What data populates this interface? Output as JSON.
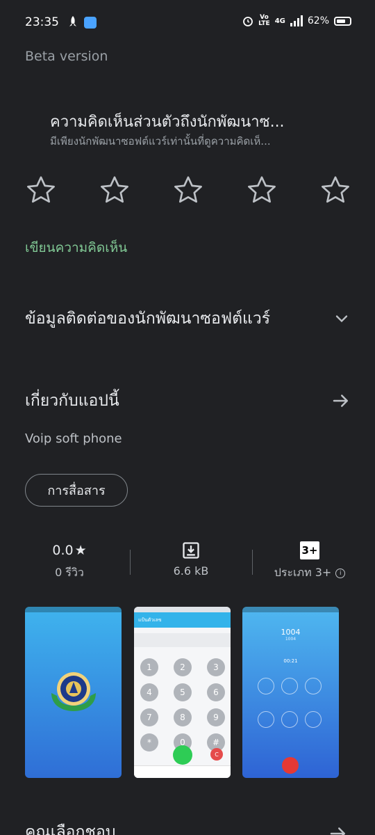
{
  "status_bar": {
    "time": "23:35",
    "volte": "Vo\nLTE",
    "network": "4G",
    "battery_percent": "62%",
    "icons": [
      "rocket-icon",
      "android-icon",
      "alarm-icon",
      "signal-icon",
      "battery-icon"
    ]
  },
  "beta_label": "Beta version",
  "review": {
    "title": "ความคิดเห็นส่วนตัวถึงนักพัฒนาซ...",
    "subtitle": "มีเพียงนักพัฒนาซอฟต์แวร์เท่านั้นที่ดูความคิดเห็...",
    "star_count": 5,
    "write_review": "เขียนความคิดเห็น"
  },
  "developer_contact": {
    "title": "ข้อมูลติดต่อของนักพัฒนาซอฟต์แวร์"
  },
  "about": {
    "title": "เกี่ยวกับแอปนี้",
    "description": "Voip soft phone",
    "category_chip": "การสื่อสาร"
  },
  "stats": {
    "rating": "0.0",
    "rating_star": "★",
    "reviews": "0 รีวิว",
    "size": "6.6 kB",
    "age_badge": "3+",
    "age_label": "ประเภท 3+"
  },
  "screenshots": {
    "shot2_header": "แป้นตัวเลข",
    "keys": [
      "1",
      "2",
      "3",
      "4",
      "5",
      "6",
      "7",
      "8",
      "9",
      "*",
      "0",
      "#"
    ],
    "delete_label": "C",
    "shot3_number": "1004",
    "shot3_sub": "1004",
    "shot3_timer": "00:21"
  },
  "bottom_section": {
    "title": "คุณเลือกชอบ"
  },
  "colors": {
    "background": "#202124",
    "accent_green": "#81c995"
  }
}
